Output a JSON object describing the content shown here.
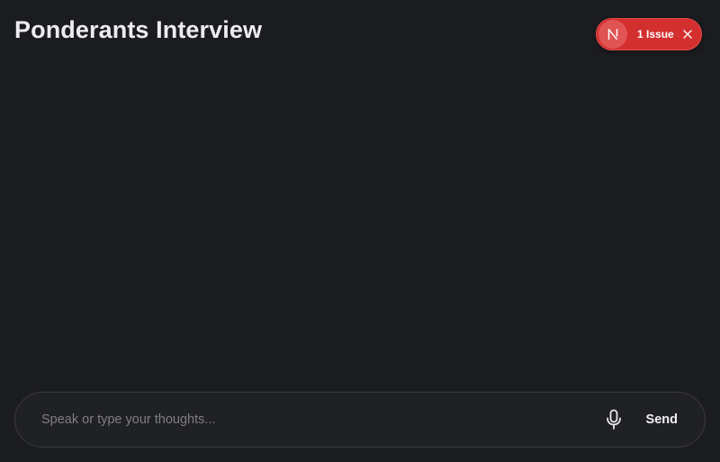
{
  "header": {
    "title": "Ponderants Interview"
  },
  "dev_badge": {
    "logo_letter": "N",
    "issues_label": "1 Issue",
    "dismiss_icon": "close-icon",
    "color": "#d32f2f"
  },
  "composer": {
    "placeholder": "Speak or type your thoughts...",
    "value": "",
    "mic_icon": "microphone-icon",
    "send_label": "Send"
  },
  "colors": {
    "background": "#1b1c1f",
    "composer_background": "#202124",
    "composer_border": "#3a3b40"
  }
}
